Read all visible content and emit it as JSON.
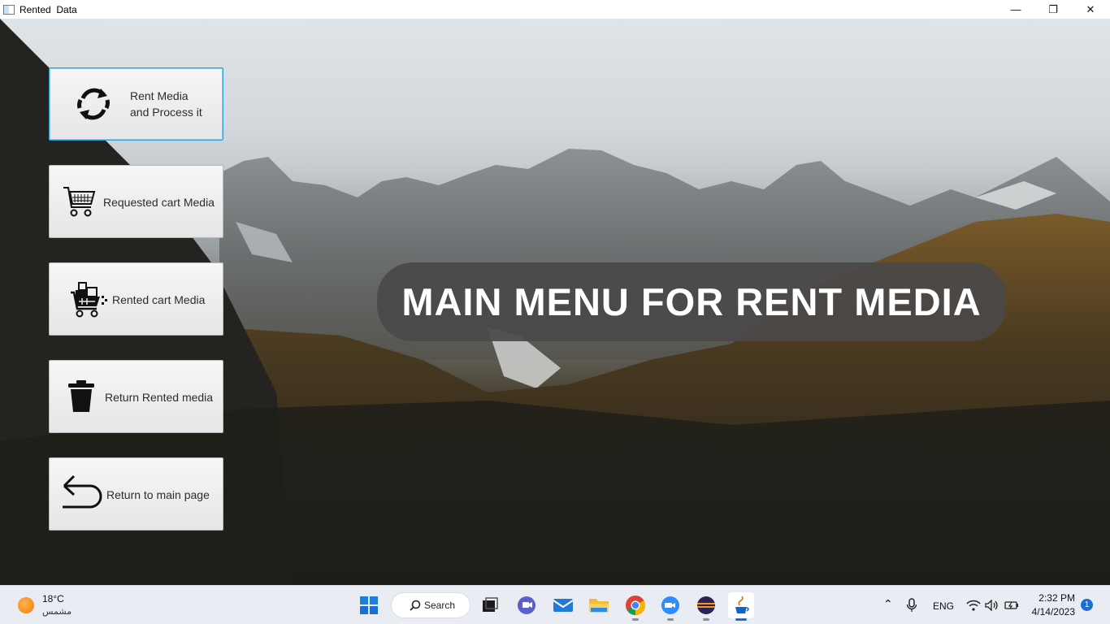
{
  "window": {
    "title": "Rented  Data",
    "controls": {
      "minimize": "—",
      "maximize": "❐",
      "close": "✕"
    }
  },
  "menu": {
    "buttons": [
      {
        "label_line1": "Rent Media",
        "label_line2": "and Process it",
        "icon": "refresh-icon"
      },
      {
        "label": "Requested cart Media",
        "icon": "shopping-cart-icon"
      },
      {
        "label": "Rented cart Media",
        "icon": "loaded-cart-icon"
      },
      {
        "label": "Return Rented media",
        "icon": "trash-icon"
      },
      {
        "label": "Return to main page",
        "icon": "return-arrow-icon"
      }
    ]
  },
  "heading": {
    "text": "MAIN MENU FOR RENT MEDIA"
  },
  "taskbar": {
    "weather": {
      "temp": "18°C",
      "desc": "مشمس"
    },
    "search_label": "Search",
    "language": "ENG",
    "time": "2:32 PM",
    "date": "4/14/2023",
    "notifications": "1"
  },
  "colors": {
    "accent": "#2a9fd8",
    "heading_bg": "#4a4848",
    "taskbar_bg": "#e9edf3",
    "windows_blue": "#1a6fd6"
  }
}
